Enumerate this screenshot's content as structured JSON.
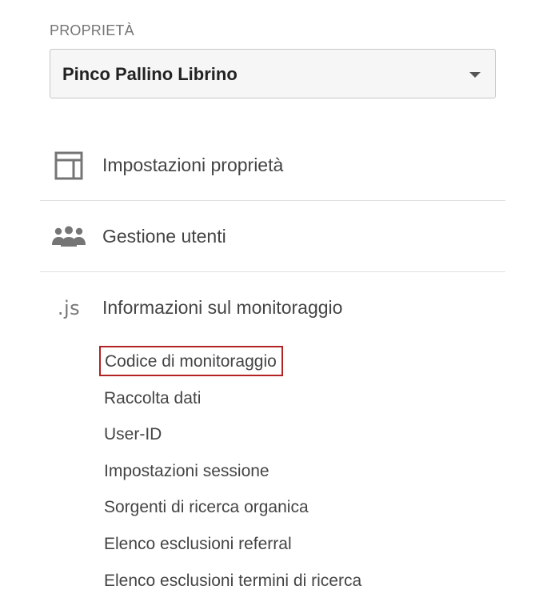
{
  "property_section": {
    "label": "PROPRIETÀ",
    "selected_property": "Pinco Pallino Librino"
  },
  "nav": {
    "items": [
      {
        "label": "Impostazioni proprietà",
        "icon": "layout-panel-icon"
      },
      {
        "label": "Gestione utenti",
        "icon": "users-group-icon"
      },
      {
        "label": "Informazioni sul monitoraggio",
        "icon": "js-icon",
        "icon_text": ".js"
      }
    ]
  },
  "tracking_submenu": {
    "items": [
      "Codice di monitoraggio",
      "Raccolta dati",
      "User-ID",
      "Impostazioni sessione",
      "Sorgenti di ricerca organica",
      "Elenco esclusioni referral",
      "Elenco esclusioni termini di ricerca"
    ],
    "highlighted_item": "Codice di monitoraggio",
    "highlight_color": "#b22222"
  }
}
